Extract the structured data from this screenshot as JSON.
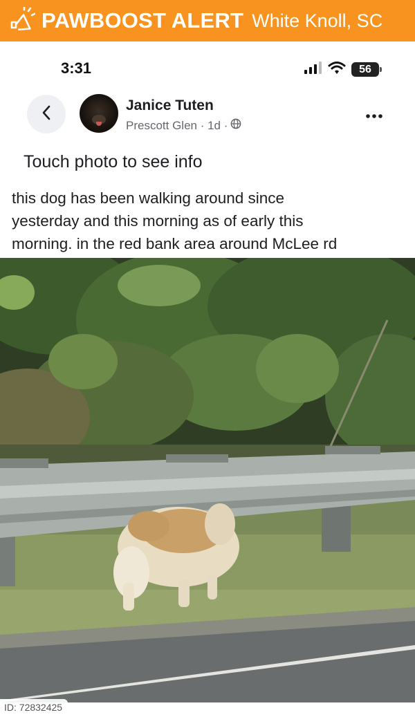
{
  "alert": {
    "brand": "PAWBOOST ALERT",
    "location": "White Knoll, SC",
    "color": "#f7931e"
  },
  "status_bar": {
    "time": "3:31",
    "battery": "56"
  },
  "post": {
    "author_name": "Janice Tuten",
    "author_meta": "Prescott Glen · 1d ·",
    "touch_hint": "Touch photo to see info",
    "text_lines": [
      "this dog has been walking around since",
      "yesterday and this morning as of early this",
      "morning. in the red bank area around McLee rd"
    ]
  },
  "photo": {
    "id_label": "ID: 72832425"
  }
}
